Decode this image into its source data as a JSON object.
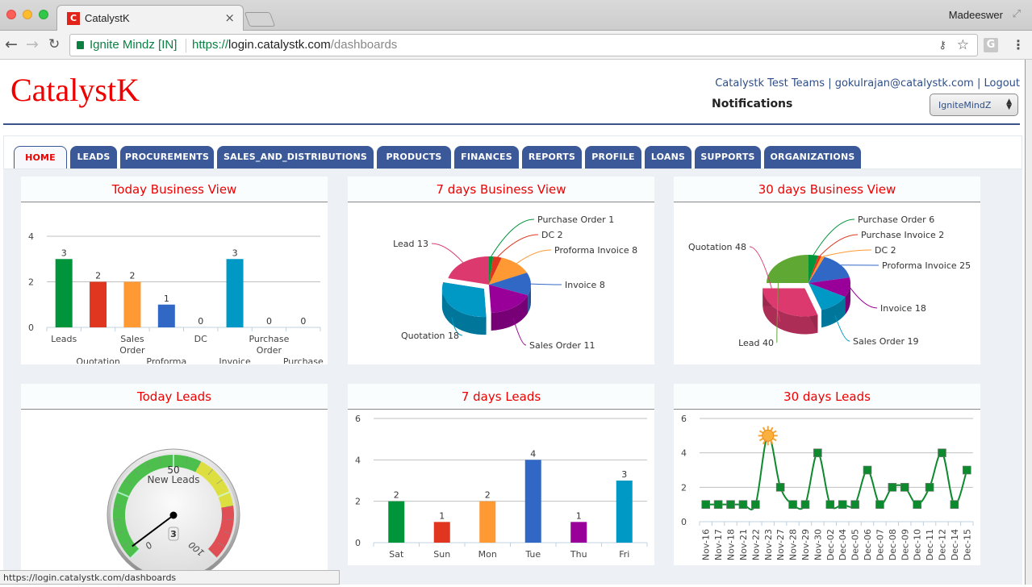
{
  "browser": {
    "tab_title": "CatalystK",
    "favicon": "C",
    "profile_name": "Madeeswer",
    "site_identity": "Ignite Mindz [IN]",
    "url_scheme": "https://",
    "url_host": "login.catalystk.com",
    "url_path": "/dashboards",
    "status_url": "https://login.catalystk.com/dashboards",
    "extension_letter": "G"
  },
  "header": {
    "logo": "CatalystK",
    "team": "Catalystk Test Teams",
    "email": "gokulrajan@catalystk.com",
    "logout": "Logout",
    "separator": "|",
    "notifications": "Notifications",
    "org_select_value": "IgniteMindZ"
  },
  "nav_tabs": [
    {
      "label": "HOME",
      "active": true
    },
    {
      "label": "LEADS"
    },
    {
      "label": "PROCUREMENTS"
    },
    {
      "label": "SALES_AND_DISTRIBUTIONS"
    },
    {
      "label": "PRODUCTS"
    },
    {
      "label": "FINANCES"
    },
    {
      "label": "REPORTS"
    },
    {
      "label": "PROFILE"
    },
    {
      "label": "LOANS"
    },
    {
      "label": "SUPPORTS"
    },
    {
      "label": "ORGANIZATIONS"
    }
  ],
  "colors": {
    "accent": "#3b5998",
    "title_red": "#ee0000",
    "green": "#00953a",
    "red": "#e0361f",
    "orange": "#ff9933",
    "blue": "#3168c6",
    "purple": "#990099",
    "teal": "#0099c6",
    "pink": "#dc3a6e",
    "lime": "#5fa834"
  },
  "chart_data": [
    {
      "id": "today_business",
      "type": "bar",
      "title": "Today Business View",
      "categories": [
        "Leads",
        "Quotation",
        "Sales Order",
        "Proforma",
        "DC",
        "Invoice",
        "Purchase Order",
        "Purchase Invoice"
      ],
      "values": [
        3,
        2,
        2,
        1,
        0,
        3,
        0,
        0
      ],
      "colors": [
        "#00953a",
        "#e0361f",
        "#ff9933",
        "#3168c6",
        "#990099",
        "#0099c6",
        "#dc3a6e",
        "#5fa834"
      ],
      "ylim": [
        0,
        4
      ],
      "yticks": [
        0,
        2,
        4
      ],
      "grid": true
    },
    {
      "id": "seven_day_business",
      "type": "pie",
      "title": "7 days Business View",
      "slices": [
        {
          "label": "Purchase Order",
          "value": 1,
          "color": "#00953a"
        },
        {
          "label": "DC",
          "value": 2,
          "color": "#e0361f"
        },
        {
          "label": "Proforma Invoice",
          "value": 8,
          "color": "#ff9933"
        },
        {
          "label": "Invoice",
          "value": 8,
          "color": "#3168c6"
        },
        {
          "label": "Sales Order",
          "value": 11,
          "color": "#990099"
        },
        {
          "label": "Quotation",
          "value": 18,
          "color": "#0099c6",
          "exploded": true
        },
        {
          "label": "Lead",
          "value": 13,
          "color": "#dc3a6e"
        }
      ]
    },
    {
      "id": "thirty_day_business",
      "type": "pie",
      "title": "30 days Business View",
      "slices": [
        {
          "label": "Purchase Order",
          "value": 6,
          "color": "#00953a"
        },
        {
          "label": "Purchase Invoice",
          "value": 2,
          "color": "#e0361f"
        },
        {
          "label": "DC",
          "value": 2,
          "color": "#ff9933"
        },
        {
          "label": "Proforma Invoice",
          "value": 25,
          "color": "#3168c6"
        },
        {
          "label": "Invoice",
          "value": 18,
          "color": "#990099"
        },
        {
          "label": "Sales Order",
          "value": 19,
          "color": "#0099c6"
        },
        {
          "label": "Quotation",
          "value": 48,
          "color": "#dc3a6e",
          "exploded": true
        },
        {
          "label": "Lead",
          "value": 40,
          "color": "#5fa834"
        }
      ]
    },
    {
      "id": "today_leads",
      "type": "gauge",
      "title": "Today Leads",
      "label": "New Leads",
      "value": 3,
      "min": 0,
      "max": 100,
      "mid_label": "50",
      "min_label": "0",
      "max_label": "100",
      "bands": [
        {
          "from": 0,
          "to": 60,
          "color": "#4cbf4c"
        },
        {
          "from": 60,
          "to": 80,
          "color": "#dddf40"
        },
        {
          "from": 80,
          "to": 100,
          "color": "#e04f55"
        }
      ]
    },
    {
      "id": "seven_day_leads",
      "type": "bar",
      "title": "7 days Leads",
      "categories": [
        "Sat",
        "Sun",
        "Mon",
        "Tue",
        "Thu",
        "Fri"
      ],
      "values": [
        2,
        1,
        2,
        4,
        1,
        3
      ],
      "colors": [
        "#00953a",
        "#e0361f",
        "#ff9933",
        "#3168c6",
        "#990099",
        "#0099c6"
      ],
      "ylim": [
        0,
        6
      ],
      "yticks": [
        0,
        2,
        4,
        6
      ],
      "grid": true
    },
    {
      "id": "thirty_day_leads",
      "type": "line",
      "title": "30 days Leads",
      "x": [
        "Nov-16",
        "Nov-17",
        "Nov-18",
        "Nov-21",
        "Nov-22",
        "Nov-23",
        "Nov-27",
        "Nov-28",
        "Nov-29",
        "Nov-30",
        "Dec-02",
        "Dec-04",
        "Dec-05",
        "Dec-06",
        "Dec-07",
        "Dec-08",
        "Dec-09",
        "Dec-10",
        "Dec-11",
        "Dec-12",
        "Dec-14",
        "Dec-15"
      ],
      "values": [
        1,
        1,
        1,
        1,
        1,
        5,
        2,
        1,
        1,
        4,
        1,
        1,
        1,
        3,
        1,
        2,
        2,
        1,
        2,
        4,
        1,
        3
      ],
      "highlight_index": 5,
      "color": "#0e8a2e",
      "ylim": [
        0,
        6
      ],
      "yticks": [
        0,
        2,
        4,
        6
      ],
      "grid": true
    }
  ]
}
